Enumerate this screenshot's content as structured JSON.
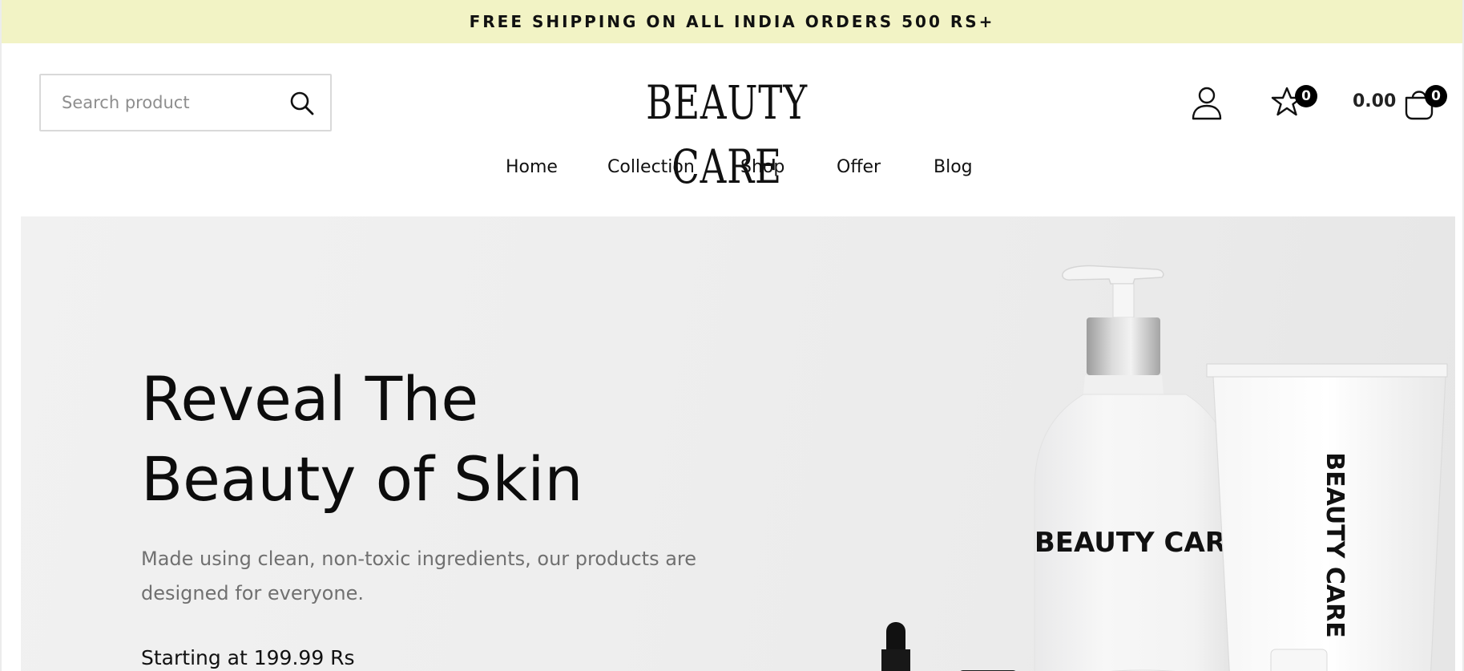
{
  "announcement": {
    "text": "FREE SHIPPING ON ALL INDIA ORDERS 500 RS+"
  },
  "header": {
    "search": {
      "placeholder": "Search product",
      "icon": "search-icon"
    },
    "logo_text": "BEAUTY CARE",
    "account_icon": "user-icon",
    "wishlist": {
      "icon": "star-icon",
      "count": "0"
    },
    "cart": {
      "icon": "shopping-bag-icon",
      "total": "0.00",
      "count": "0"
    }
  },
  "nav": {
    "items": [
      {
        "label": "Home"
      },
      {
        "label": "Collection"
      },
      {
        "label": "Shop"
      },
      {
        "label": "Offer"
      },
      {
        "label": "Blog"
      }
    ]
  },
  "hero": {
    "title_line1": "Reveal The",
    "title_line2": "Beauty of Skin",
    "description": "Made using clean, non-toxic ingredients, our products are designed for everyone.",
    "price_text": "Starting at 199.99 Rs",
    "product_label_bottle": "BEAUTY CARE",
    "product_label_tube": "BEAUTY CARE"
  },
  "colors": {
    "announcement_bg": "#f2f3c5",
    "hero_bg": "#eeeeee",
    "text_primary": "#111111",
    "text_muted": "#707070",
    "badge_bg": "#000000"
  }
}
